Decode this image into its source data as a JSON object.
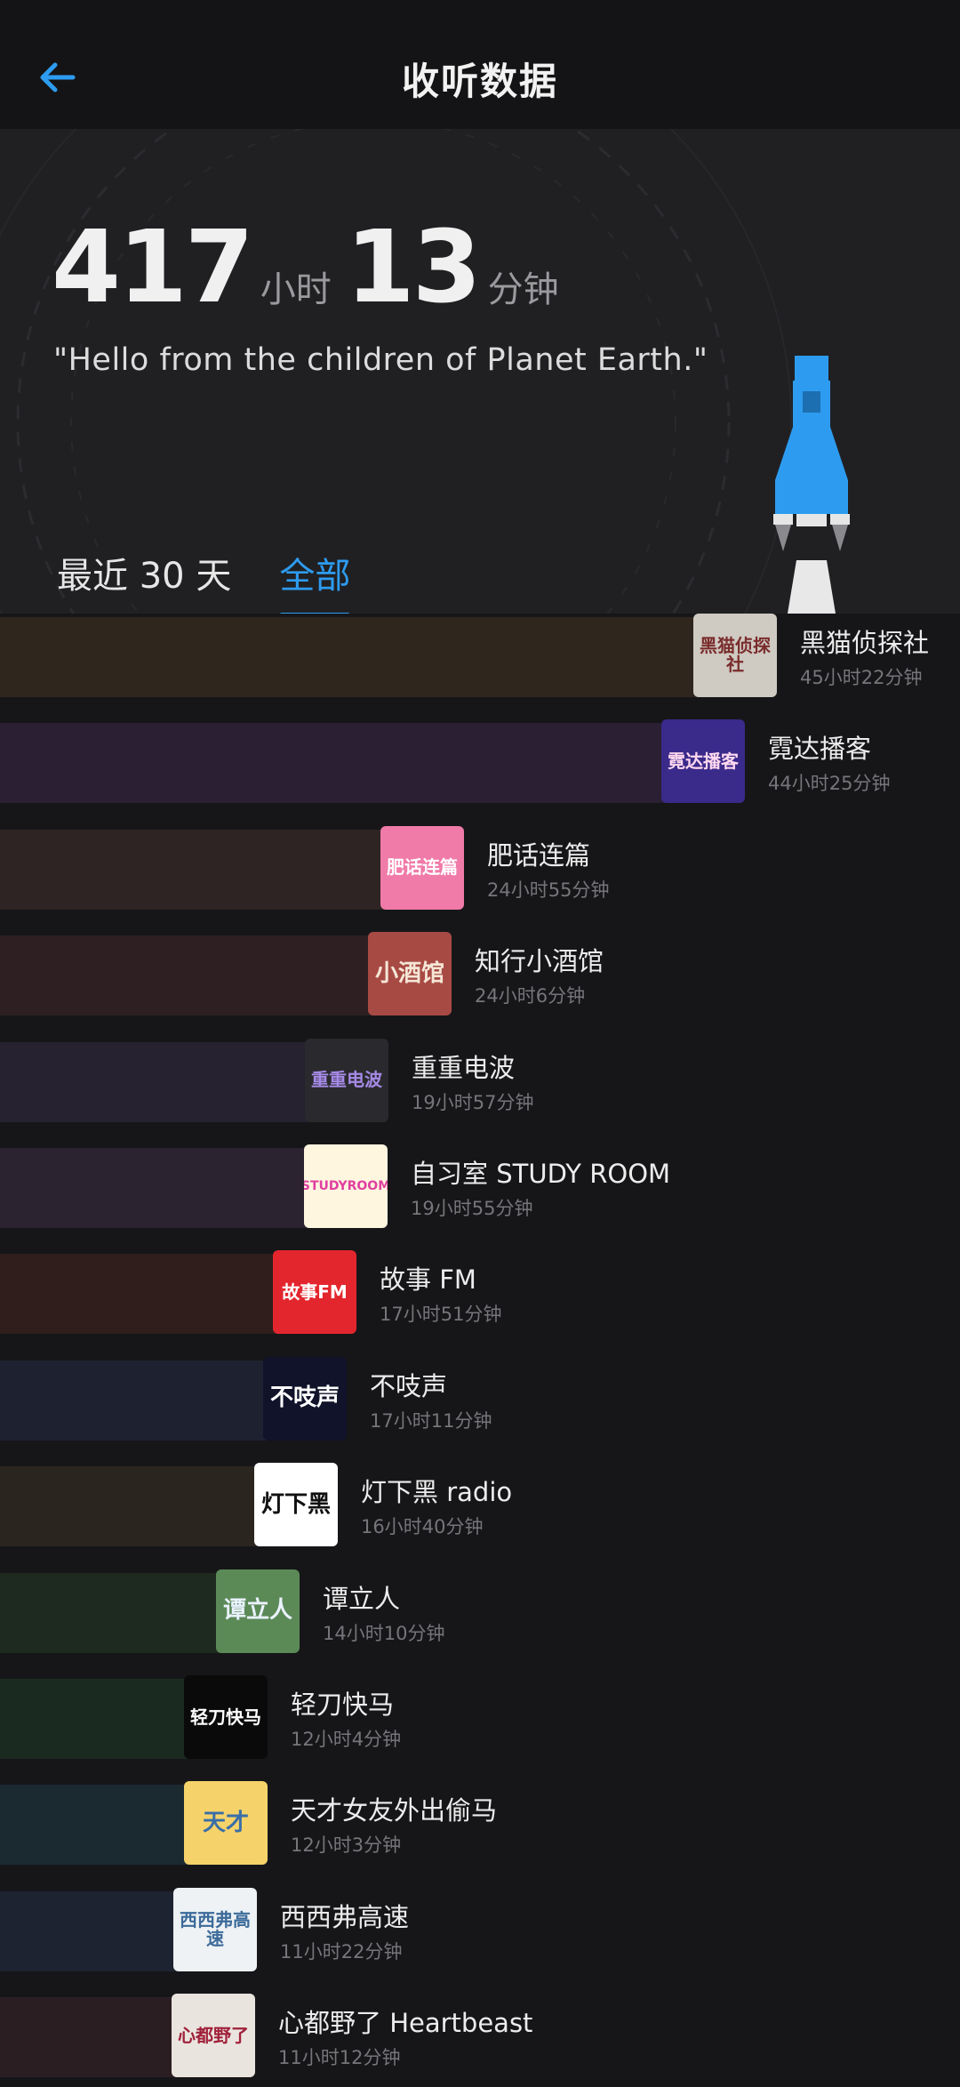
{
  "header": {
    "title": "收听数据"
  },
  "summary": {
    "hours": "417",
    "hours_unit": "小时",
    "minutes": "13",
    "minutes_unit": "分钟",
    "quote": "\"Hello from the children of Planet Earth.\""
  },
  "tabs": [
    {
      "label": "最近 30 天",
      "active": false
    },
    {
      "label": "全部",
      "active": true
    }
  ],
  "podcasts": [
    {
      "name": "黑猫侦探社",
      "duration": "45小时22分钟",
      "cover_text": "黑猫侦探社",
      "bar_color": "#2f261e",
      "cover_bg": "#cfcac2",
      "cover_fg": "#7a2c2c",
      "share": 1.0
    },
    {
      "name": "霓达播客",
      "duration": "44小时25分钟",
      "cover_text": "霓达播客",
      "bar_color": "#2a1f33",
      "cover_bg": "#3a2a8a",
      "cover_fg": "#ffd8f0",
      "share": 0.979
    },
    {
      "name": "肥话连篇",
      "duration": "24小时55分钟",
      "cover_text": "肥话连篇",
      "bar_color": "#2e2424",
      "cover_bg": "#f07aa8",
      "cover_fg": "#ffffff",
      "share": 0.549
    },
    {
      "name": "知行小酒馆",
      "duration": "24小时6分钟",
      "cover_text": "小酒馆",
      "bar_color": "#2e2022",
      "cover_bg": "#a84a44",
      "cover_fg": "#f4e6d6",
      "share": 0.531
    },
    {
      "name": "重重电波",
      "duration": "19小时57分钟",
      "cover_text": "重重电波",
      "bar_color": "#26222f",
      "cover_bg": "#2a2a2e",
      "cover_fg": "#a58ae6",
      "share": 0.44
    },
    {
      "name": "自习室 STUDY ROOM",
      "duration": "19小时55分钟",
      "cover_text": "STUDYROOM",
      "bar_color": "#2c2331",
      "cover_bg": "#fff6e0",
      "cover_fg": "#e040a0",
      "share": 0.439
    },
    {
      "name": "故事 FM",
      "duration": "17小时51分钟",
      "cover_text": "故事FM",
      "bar_color": "#2f1e1c",
      "cover_bg": "#e3262d",
      "cover_fg": "#ffffff",
      "share": 0.393
    },
    {
      "name": "不吱声",
      "duration": "17小时11分钟",
      "cover_text": "不吱声",
      "bar_color": "#1e2230",
      "cover_bg": "#10132a",
      "cover_fg": "#ffffff",
      "share": 0.379
    },
    {
      "name": "灯下黑 radio",
      "duration": "16小时40分钟",
      "cover_text": "灯下黑",
      "bar_color": "#2b2520",
      "cover_bg": "#ffffff",
      "cover_fg": "#111111",
      "share": 0.367
    },
    {
      "name": "谭立人",
      "duration": "14小时10分钟",
      "cover_text": "谭立人",
      "bar_color": "#1e2a20",
      "cover_bg": "#5b8a57",
      "cover_fg": "#eaf2ff",
      "share": 0.312
    },
    {
      "name": "轻刀快马",
      "duration": "12小时4分钟",
      "cover_text": "轻刀快马",
      "bar_color": "#1b2a20",
      "cover_bg": "#0a0a0a",
      "cover_fg": "#ffffff",
      "share": 0.266
    },
    {
      "name": "天才女友外出偷马",
      "duration": "12小时3分钟",
      "cover_text": "天才",
      "bar_color": "#1b2a31",
      "cover_bg": "#f6d36a",
      "cover_fg": "#3a6ea8",
      "share": 0.266
    },
    {
      "name": "西西弗高速",
      "duration": "11小时22分钟",
      "cover_text": "西西弗高速",
      "bar_color": "#1d2330",
      "cover_bg": "#eef2f4",
      "cover_fg": "#3c6b9a",
      "share": 0.25
    },
    {
      "name": "心都野了 Heartbeast",
      "duration": "11小时12分钟",
      "cover_text": "心都野了",
      "bar_color": "#2b1e22",
      "cover_bg": "#eae4de",
      "cover_fg": "#a0203a",
      "share": 0.247
    }
  ],
  "colors": {
    "accent": "#2d9cf0",
    "background": "#161619",
    "hero": "#202023"
  }
}
